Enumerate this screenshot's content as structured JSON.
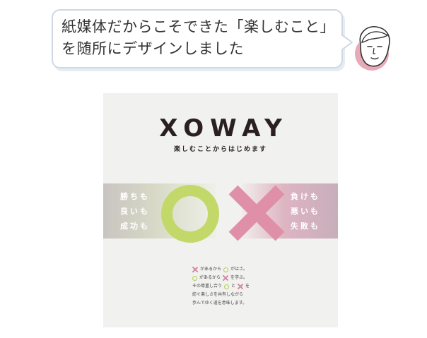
{
  "speech_bubble": {
    "line1": "紙媒体だからこそできた「楽しむこと」",
    "line2": "を随所にデザインしました"
  },
  "poster": {
    "logo": "XOWAY",
    "tagline": "楽しむことからはじめます",
    "left_lines": [
      "勝ちも",
      "良いも",
      "成功も"
    ],
    "right_lines": [
      "負けも",
      "悪いも",
      "失敗も"
    ],
    "legend": {
      "row1_a": "があるから",
      "row1_b": "がはさ。",
      "row2_a": "があるから",
      "row2_b": "を学ぶ。"
    },
    "description": {
      "line1_a": "その尊重し合う",
      "line1_b": "と",
      "line1_c": "を",
      "line2": "紡ぐ楽しさを共有しながら",
      "line3": "歩んでゆく道を意味します。"
    }
  },
  "colors": {
    "circle_green": "#c2d96a",
    "cross_pink": "#e08fa8",
    "avatar_cheek": "#e8a9b8",
    "bubble_border": "#cfd8e3"
  },
  "icons": {
    "avatar": "person-face-icon",
    "circle": "circle-mark-icon",
    "cross": "cross-mark-icon"
  }
}
